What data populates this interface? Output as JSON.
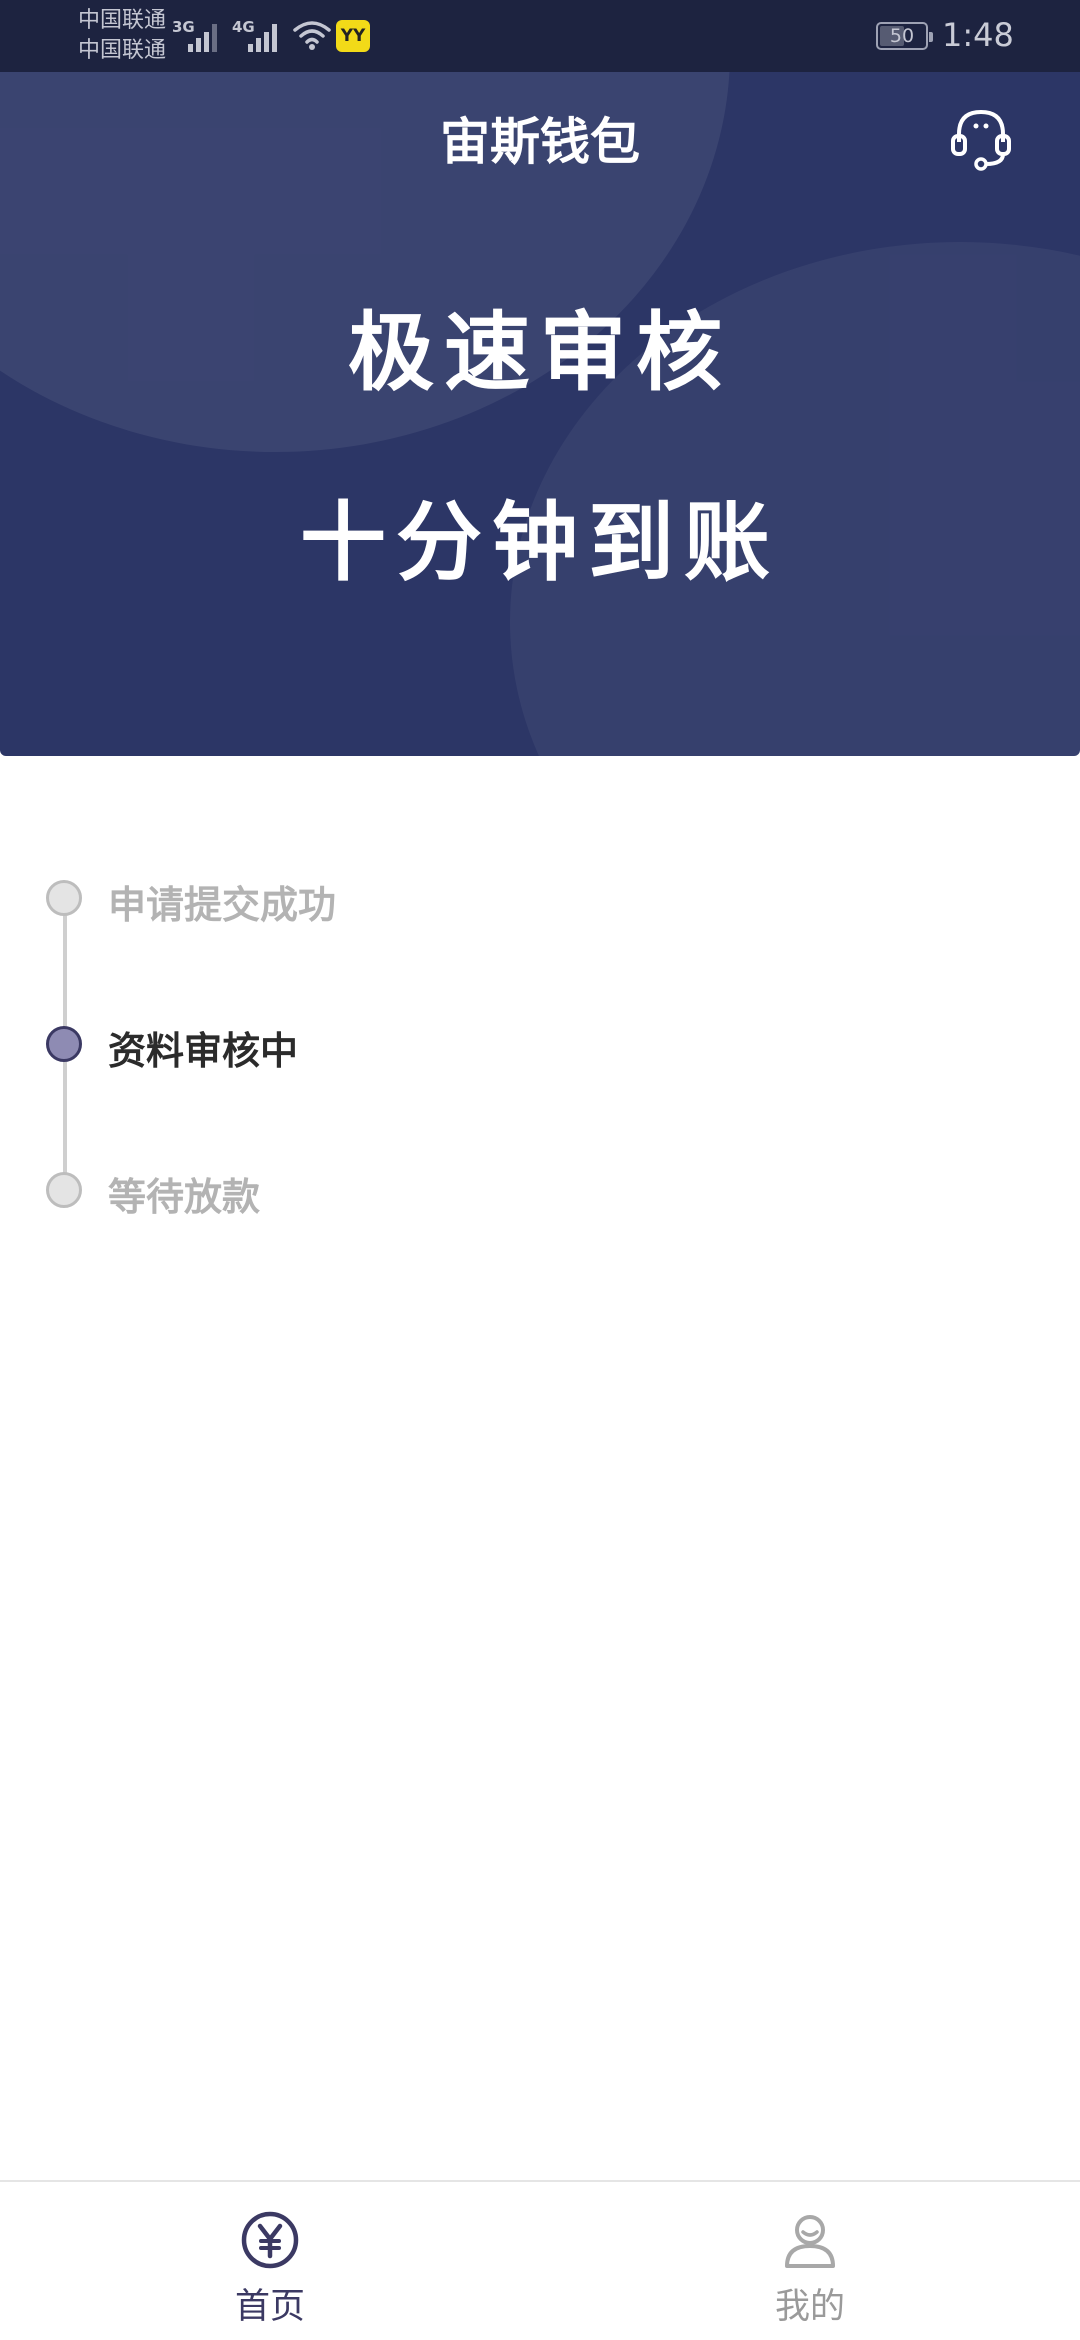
{
  "status_bar": {
    "carrier_1": "中国联通",
    "carrier_2": "中国联通",
    "network_1": "3G",
    "network_2": "4G",
    "yy_badge": "YY",
    "battery": "50",
    "time": "1:48"
  },
  "header": {
    "title": "宙斯钱包",
    "slogan_line1": "极速审核",
    "slogan_line2": "十分钟到账",
    "support_icon": "headset-icon",
    "background_color": "#2c3666"
  },
  "progress": {
    "steps": [
      {
        "label": "申请提交成功",
        "state": "done"
      },
      {
        "label": "资料审核中",
        "state": "current"
      },
      {
        "label": "等待放款",
        "state": "pending"
      }
    ]
  },
  "bottom_nav": {
    "items": [
      {
        "label": "首页",
        "icon": "yuan-icon",
        "active": true
      },
      {
        "label": "我的",
        "icon": "user-icon",
        "active": false
      }
    ],
    "active_color": "#3b3963",
    "inactive_color": "#9a9a9a"
  }
}
